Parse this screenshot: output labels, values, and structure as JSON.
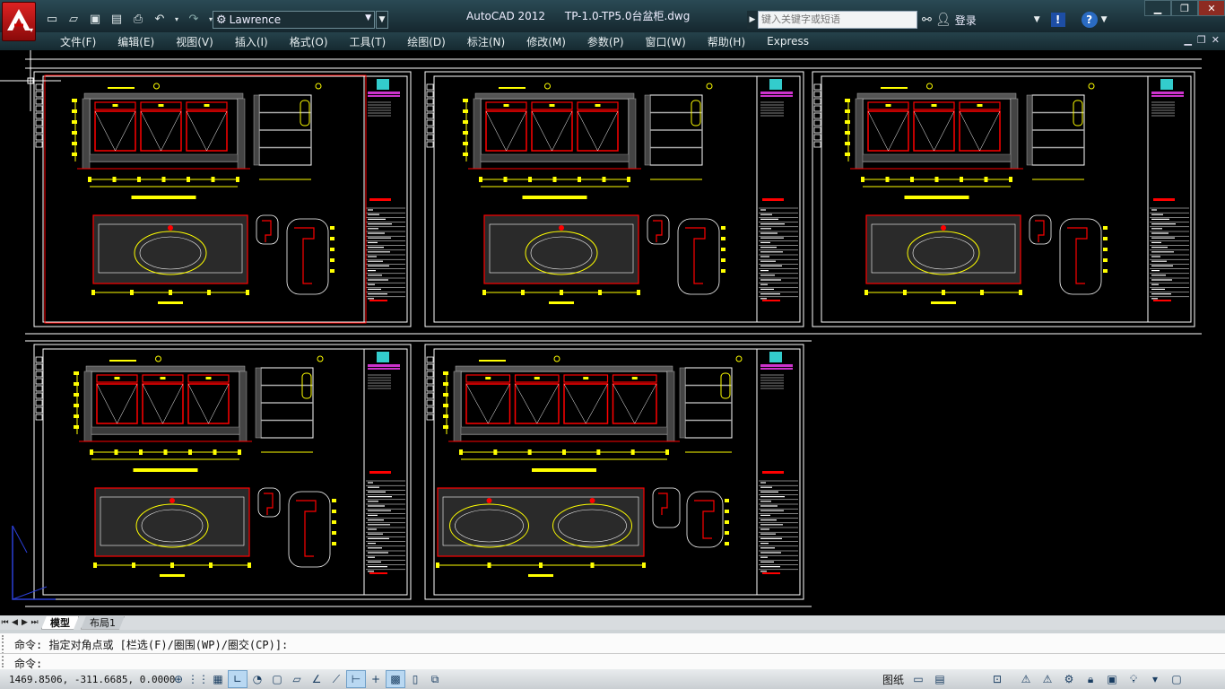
{
  "app": {
    "title": "AutoCAD 2012",
    "file": "TP-1.0-TP5.0台盆柜.dwg",
    "workspace": "Lawrence",
    "search_placeholder": "键入关键字或短语",
    "login_label": "登录"
  },
  "menu": [
    "文件(F)",
    "编辑(E)",
    "视图(V)",
    "插入(I)",
    "格式(O)",
    "工具(T)",
    "绘图(D)",
    "标注(N)",
    "修改(M)",
    "参数(P)",
    "窗口(W)",
    "帮助(H)",
    "Express"
  ],
  "tabs": [
    {
      "label": "模型",
      "active": true
    },
    {
      "label": "布局1",
      "active": false
    }
  ],
  "command": {
    "history": "命令: 指定对角点或 [栏选(F)/圈围(WP)/圈交(CP)]:",
    "prompt": "命令:"
  },
  "status": {
    "coordinates": "1469.8506, -311.6685, 0.0000",
    "layout_label": "图纸"
  },
  "colors": {
    "canvas": "#000000",
    "dim_yellow": "#ffff00",
    "cabinet_red": "#ff0000",
    "frame_white": "#ffffff",
    "title_magenta": "#cc33cc",
    "logo_cyan": "#33cccc"
  },
  "icons": {
    "quick_access": [
      "new-icon",
      "open-icon",
      "save-icon",
      "save-as-icon",
      "plot-icon",
      "undo-icon",
      "redo-icon"
    ],
    "status_toggles": [
      "snap-icon",
      "grid-icon",
      "ortho-icon",
      "polar-icon",
      "osnap-icon",
      "3d-osnap-icon",
      "otrack-icon",
      "ducs-icon",
      "dyn-icon",
      "lineweight-icon",
      "transparency-icon",
      "qp-icon",
      "sc-icon"
    ]
  }
}
